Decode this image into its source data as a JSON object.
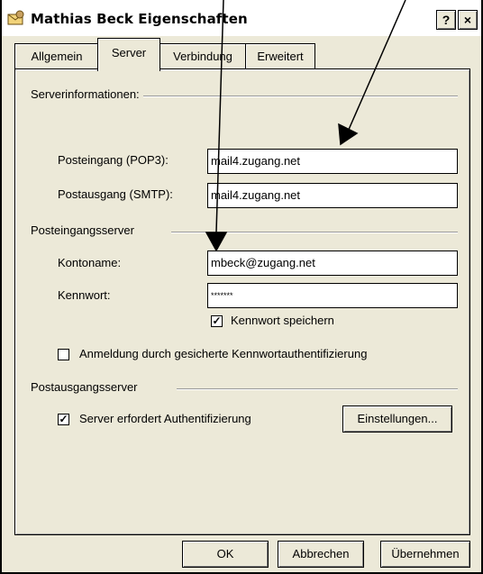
{
  "window": {
    "title": "Mathias Beck Eigenschaften",
    "help_button": "?",
    "close_button": "×",
    "icon": "mail-account-icon"
  },
  "tabs": [
    {
      "label": "Allgemein",
      "active": false
    },
    {
      "label": "Server",
      "active": true
    },
    {
      "label": "Verbindung",
      "active": false
    },
    {
      "label": "Erweitert",
      "active": false
    }
  ],
  "server_info": {
    "group_title": "Serverinformationen:",
    "incoming_label": "Posteingang (POP3):",
    "incoming_value": "mail4.zugang.net",
    "outgoing_label": "Postausgang (SMTP):",
    "outgoing_value": "mail4.zugang.net"
  },
  "incoming_server": {
    "group_title": "Posteingangsserver",
    "account_label": "Kontoname:",
    "account_value": "mbeck@zugang.net",
    "password_label": "Kennwort:",
    "password_value": "*******",
    "remember_label": "Kennwort speichern",
    "remember_checked": true,
    "spa_label": "Anmeldung durch gesicherte Kennwortauthentifizierung",
    "spa_checked": false
  },
  "outgoing_server": {
    "group_title": "Postausgangsserver",
    "auth_label": "Server erfordert Authentifizierung",
    "auth_checked": true,
    "settings_button": "Einstellungen..."
  },
  "footer": {
    "ok": "OK",
    "cancel": "Abbrechen",
    "apply": "Übernehmen"
  },
  "colors": {
    "dialog_bg": "#ece9d8",
    "annotation_arrows": "#000000"
  }
}
